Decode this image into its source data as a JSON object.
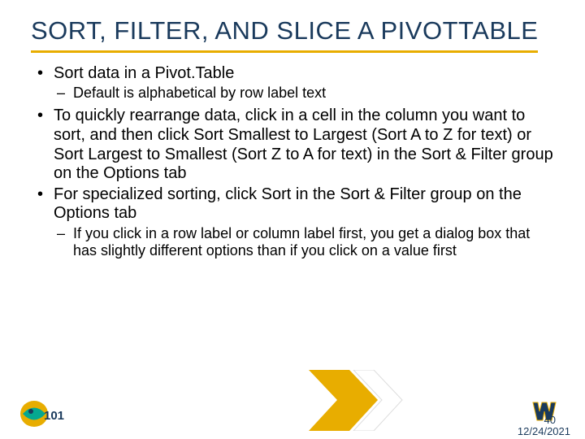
{
  "title": "SORT, FILTER, AND SLICE A PIVOTTABLE",
  "bullets": {
    "b1": "Sort data in a Pivot.Table",
    "s1": "Default is alphabetical by row label text",
    "b2": "To quickly rearrange data, click in a cell in the column you want to sort, and then click Sort Smallest to Largest (Sort A to Z for text) or Sort Largest to Smallest (Sort Z to A for text) in the Sort & Filter group on the Options tab",
    "b3": "For specialized sorting, click Sort in the Sort & Filter group on the Options tab",
    "s2": "If you click in a row label or column label first, you get a dialog box that has slightly different options than if you click on a value first"
  },
  "page": "40",
  "date": "12/24/2021"
}
